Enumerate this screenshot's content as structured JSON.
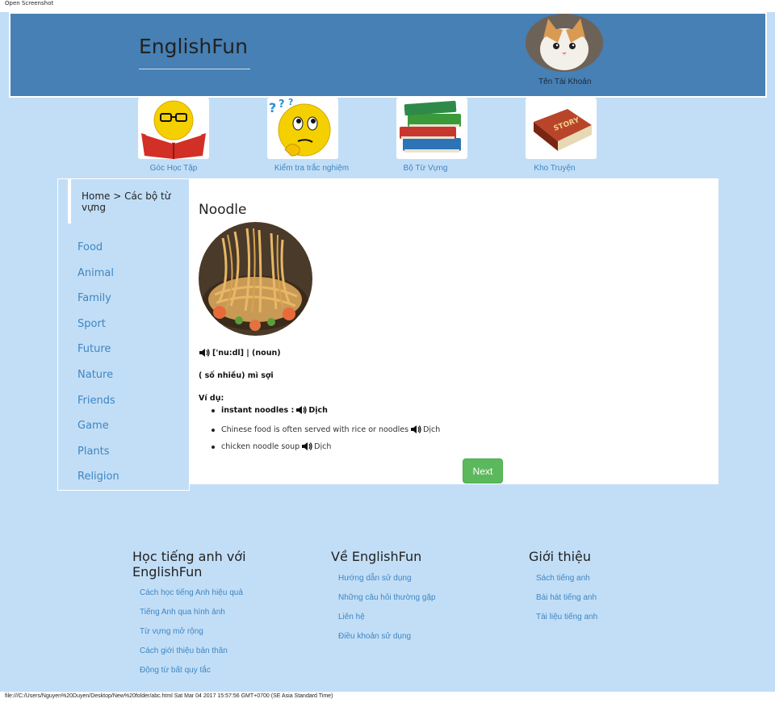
{
  "topbar": {
    "label": "Open Screenshot"
  },
  "header": {
    "brand": "EnglishFun",
    "account": "Tên Tài Khoản"
  },
  "nav": [
    {
      "label": "Góc Học Tập",
      "icon": "reading-smiley-icon"
    },
    {
      "label": "Kiểm tra trắc nghiệm",
      "icon": "thinking-smiley-icon"
    },
    {
      "label": "Bộ Từ Vựng",
      "icon": "book-stack-icon"
    },
    {
      "label": "Kho Truyện",
      "icon": "story-book-icon"
    }
  ],
  "breadcrumb": "Home > Các bộ từ vựng",
  "sidebar": [
    "Food",
    "Animal",
    "Family",
    "Sport",
    "Future",
    "Nature",
    "Friends",
    "Game",
    "Plants",
    "Religion"
  ],
  "word": {
    "title": "Noodle",
    "pronunciation": "['nu:dl] | (noun)",
    "meaning": "( số nhiều) mì sợi",
    "examples_label": "Ví dụ:",
    "examples": [
      {
        "text": "instant noodles :",
        "action": "Dịch"
      },
      {
        "text": "Chinese food is often served with rice or noodles",
        "action": "Dịch"
      },
      {
        "text": "chicken noodle soup",
        "action": "Dịch"
      }
    ],
    "next": "Next"
  },
  "footer": {
    "col1": {
      "title": "Học tiếng anh với EnglishFun",
      "links": [
        "Cách học tiếng Anh hiệu quả",
        "Tiếng Anh qua hình ảnh",
        "Từ vựng mở rộng",
        "Cách giới thiệu bản thân",
        "Động từ bất quy tắc"
      ]
    },
    "col2": {
      "title": "Về EnglishFun",
      "links": [
        "Hướng dẫn sử dụng",
        "Những câu hỏi thường gặp",
        "Liên hệ",
        "Điều khoản sử dụng"
      ]
    },
    "col3": {
      "title": "Giới thiệu",
      "links": [
        "Sách tiếng anh",
        "Bài hát tiếng anh",
        "Tài liệu tiếng anh"
      ]
    }
  },
  "status": "file:///C:/Users/Nguyen%20Duyen/Desktop/New%20folder/abc.html Sat Mar 04 2017 15:57:56 GMT+0700 (SE Asia Standard Time)",
  "colors": {
    "header": "#4680b4",
    "background": "#c2def7",
    "link": "#3f86c0",
    "next": "#5cb85c"
  }
}
